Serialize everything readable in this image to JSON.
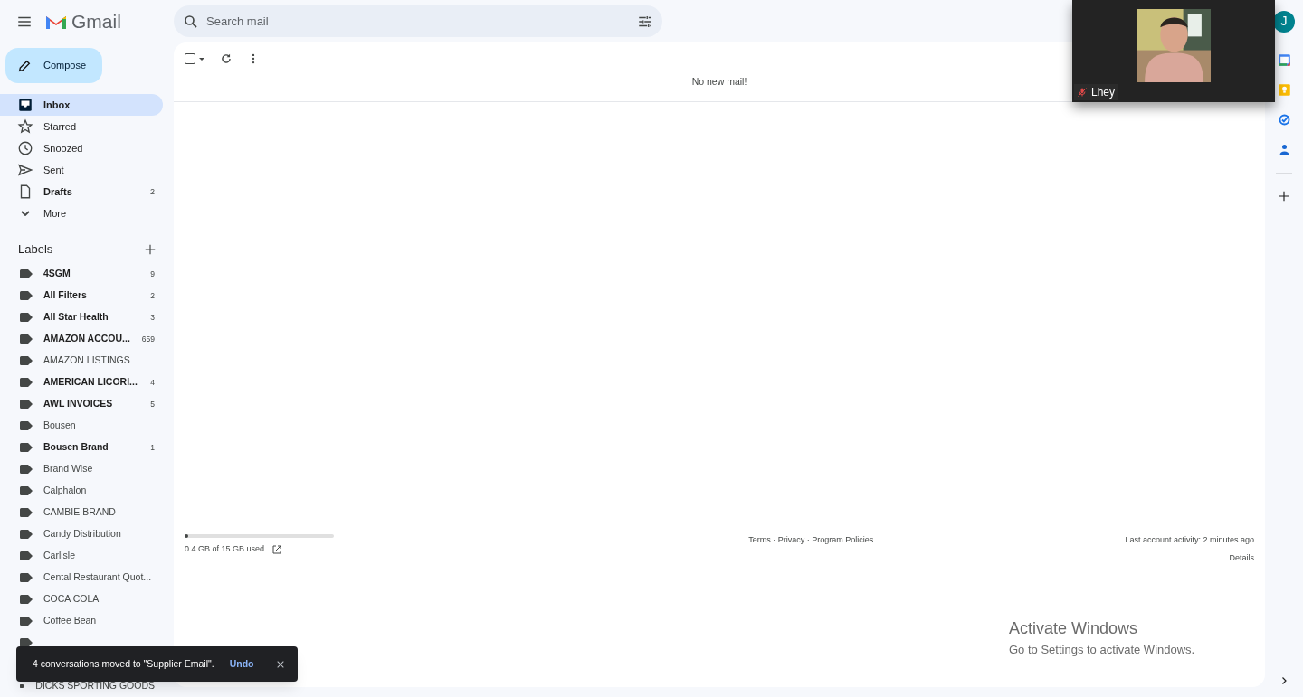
{
  "header": {
    "logo": "Gmail",
    "search": {
      "placeholder": "Search mail"
    },
    "avatar": "J"
  },
  "compose": "Compose",
  "nav": [
    {
      "kind": "inbox",
      "label": "Inbox",
      "selected": true,
      "unread": true
    },
    {
      "kind": "star",
      "label": "Starred",
      "selected": false,
      "unread": false
    },
    {
      "kind": "clock",
      "label": "Snoozed",
      "selected": false,
      "unread": false
    },
    {
      "kind": "sent",
      "label": "Sent",
      "selected": false,
      "unread": false
    },
    {
      "kind": "draft",
      "label": "Drafts",
      "count": "2",
      "selected": false,
      "unread": true
    },
    {
      "kind": "more",
      "label": "More",
      "selected": false,
      "unread": false
    }
  ],
  "labels_heading": "Labels",
  "select_all": {
    "checked": false
  },
  "labels": [
    {
      "name": "4SGM",
      "count": "9",
      "unread": true
    },
    {
      "name": "All Filters",
      "count": "2",
      "unread": true
    },
    {
      "name": "All Star Health",
      "count": "3",
      "unread": true
    },
    {
      "name": "AMAZON ACCOU...",
      "count": "659",
      "unread": true
    },
    {
      "name": "AMAZON LISTINGS",
      "unread": false
    },
    {
      "name": "AMERICAN LICORI...",
      "count": "4",
      "unread": true
    },
    {
      "name": "AWL INVOICES",
      "count": "5",
      "unread": true
    },
    {
      "name": "Bousen",
      "unread": false
    },
    {
      "name": "Bousen Brand",
      "count": "1",
      "unread": true
    },
    {
      "name": "Brand Wise",
      "unread": false
    },
    {
      "name": "Calphalon",
      "unread": false
    },
    {
      "name": "CAMBIE BRAND",
      "unread": false
    },
    {
      "name": "Candy Distribution",
      "unread": false
    },
    {
      "name": "Carlisle",
      "unread": false
    },
    {
      "name": "Cental Restaurant Quot...",
      "unread": false
    },
    {
      "name": "COCA COLA",
      "unread": false
    },
    {
      "name": "Coffee Bean",
      "unread": false
    },
    {
      "kind": "covered"
    },
    {
      "name": "DICKS SPORTING GOODS",
      "unread": false
    }
  ],
  "message": "No new mail!",
  "footer": {
    "storage": {
      "text": "0.4 GB of 15 GB used",
      "level": 0.027
    },
    "links": "Terms · Privacy · Program Policies",
    "activity": "Last account activity: 2 minutes ago",
    "details": "Details"
  },
  "toast": {
    "message": "4 conversations moved to \"Supplier Email\".",
    "action": "Undo"
  },
  "video": {
    "name": "Lhey",
    "muted": true
  },
  "watermark": {
    "title": "Activate Windows",
    "subtitle": "Go to Settings to activate Windows."
  }
}
